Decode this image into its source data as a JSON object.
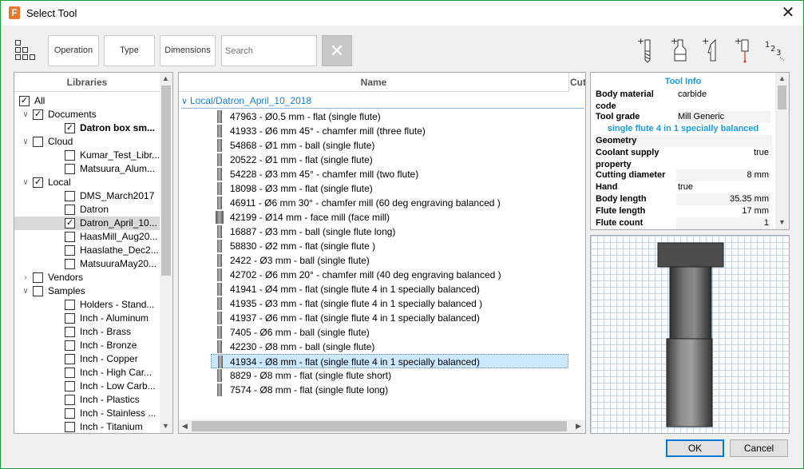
{
  "window": {
    "title": "Select Tool",
    "app_icon_letter": "F"
  },
  "toolbar": {
    "operation_label": "Operation",
    "type_label": "Type",
    "dimensions_label": "Dimensions",
    "search_placeholder": "Search",
    "icons": [
      "view-grid-icon",
      "add-mill-icon",
      "add-holder-icon",
      "add-turning-icon",
      "add-probe-icon",
      "renumber-icon"
    ],
    "renumber_label": "1 2 3"
  },
  "libraries": {
    "header": "Libraries",
    "items": [
      {
        "label": "All",
        "checked": true,
        "caret": "down",
        "level": 0
      },
      {
        "label": "Documents",
        "checked": true,
        "caret": "down",
        "level": 1
      },
      {
        "label": "Datron box sm...",
        "checked": true,
        "caret": "",
        "level": 2,
        "bold": true
      },
      {
        "label": "Cloud",
        "checked": false,
        "caret": "down",
        "level": 1
      },
      {
        "label": "Kumar_Test_Libr...",
        "checked": false,
        "caret": "",
        "level": 2
      },
      {
        "label": "Matsuura_Alum...",
        "checked": false,
        "caret": "",
        "level": 2
      },
      {
        "label": "Local",
        "checked": true,
        "caret": "down",
        "level": 1
      },
      {
        "label": "DMS_March2017",
        "checked": false,
        "caret": "",
        "level": 2
      },
      {
        "label": "Datron",
        "checked": false,
        "caret": "",
        "level": 2
      },
      {
        "label": "Datron_April_10...",
        "checked": true,
        "caret": "",
        "level": 2,
        "selected": true
      },
      {
        "label": "HaasMill_Aug20...",
        "checked": false,
        "caret": "",
        "level": 2
      },
      {
        "label": "Haaslathe_Dec2...",
        "checked": false,
        "caret": "",
        "level": 2
      },
      {
        "label": "MatsuuraMay20...",
        "checked": false,
        "caret": "",
        "level": 2
      },
      {
        "label": "Vendors",
        "checked": false,
        "caret": "right",
        "level": 1
      },
      {
        "label": "Samples",
        "checked": false,
        "caret": "down",
        "level": 1
      },
      {
        "label": "Holders - Stand...",
        "checked": false,
        "caret": "",
        "level": 2
      },
      {
        "label": "Inch - Aluminum",
        "checked": false,
        "caret": "",
        "level": 2
      },
      {
        "label": "Inch - Brass",
        "checked": false,
        "caret": "",
        "level": 2
      },
      {
        "label": "Inch - Bronze",
        "checked": false,
        "caret": "",
        "level": 2
      },
      {
        "label": "Inch - Copper",
        "checked": false,
        "caret": "",
        "level": 2
      },
      {
        "label": "Inch - High Car...",
        "checked": false,
        "caret": "",
        "level": 2
      },
      {
        "label": "Inch - Low Carb...",
        "checked": false,
        "caret": "",
        "level": 2
      },
      {
        "label": "Inch - Plastics",
        "checked": false,
        "caret": "",
        "level": 2
      },
      {
        "label": "Inch - Stainless ...",
        "checked": false,
        "caret": "",
        "level": 2
      },
      {
        "label": "Inch - Titanium",
        "checked": false,
        "caret": "",
        "level": 2
      }
    ]
  },
  "tools": {
    "column_name": "Name",
    "column_cut": "Cut",
    "group_label": "Local/Datron_April_10_2018",
    "rows": [
      {
        "text": "47963 - Ø0.5 mm - flat (single flute)",
        "icon": "endmill-icon"
      },
      {
        "text": "41933 - Ø6 mm 45° - chamfer mill (three flute)",
        "icon": "endmill-icon"
      },
      {
        "text": "54868 - Ø1 mm - ball (single flute)",
        "icon": "endmill-icon"
      },
      {
        "text": "20522 - Ø1 mm - flat (single flute)",
        "icon": "endmill-icon"
      },
      {
        "text": "54228 - Ø3 mm 45° - chamfer mill (two flute)",
        "icon": "endmill-icon"
      },
      {
        "text": "18098 - Ø3 mm - flat (single flute)",
        "icon": "endmill-icon"
      },
      {
        "text": "46911 - Ø6 mm 30° - chamfer mill (60 deg engraving balanced )",
        "icon": "endmill-icon"
      },
      {
        "text": "42199 - Ø14 mm - face mill (face mill)",
        "icon": "facemill-icon"
      },
      {
        "text": "16887 - Ø3 mm - ball (single flute long)",
        "icon": "endmill-icon"
      },
      {
        "text": "58830 - Ø2 mm - flat (single flute )",
        "icon": "endmill-icon"
      },
      {
        "text": "2422 - Ø3 mm - ball (single flute)",
        "icon": "endmill-icon"
      },
      {
        "text": "42702 - Ø6 mm 20° - chamfer mill (40 deg engraving balanced )",
        "icon": "endmill-icon"
      },
      {
        "text": "41941 - Ø4 mm - flat (single flute 4 in 1 specially balanced)",
        "icon": "endmill-icon"
      },
      {
        "text": "41935 - Ø3 mm - flat (single flute 4 in 1 specially balanced )",
        "icon": "endmill-icon"
      },
      {
        "text": "41937 - Ø6 mm - flat (single flute 4 in 1 specially balanced)",
        "icon": "endmill-icon"
      },
      {
        "text": "7405 - Ø6 mm - ball (single flute)",
        "icon": "endmill-icon"
      },
      {
        "text": "42230 - Ø8 mm - ball (single flute)",
        "icon": "endmill-icon"
      },
      {
        "text": "41934 - Ø8 mm - flat (single flute 4 in 1 specially balanced)",
        "icon": "endmill-icon",
        "selected": true
      },
      {
        "text": "8829 - Ø8 mm - flat (single flute short)",
        "icon": "endmill-icon"
      },
      {
        "text": "7574 - Ø8 mm - flat (single flute long)",
        "icon": "endmill-icon"
      }
    ]
  },
  "tool_info": {
    "header": "Tool Info",
    "body_material_key": "Body material code",
    "body_material_val": "carbide",
    "tool_grade_key": "Tool grade",
    "tool_grade_val": "Mill Generic",
    "description": "single flute 4 in 1 specially balanced",
    "geometry_label": "Geometry",
    "coolant_key": "Coolant supply property",
    "coolant_val": "true",
    "cutting_diameter_key": "Cutting diameter",
    "cutting_diameter_val": "8 mm",
    "hand_key": "Hand",
    "hand_val": "true",
    "body_length_key": "Body length",
    "body_length_val": "35.35 mm",
    "flute_length_key": "Flute length",
    "flute_length_val": "17 mm",
    "flute_count_key": "Flute count",
    "flute_count_val": "1",
    "colors": {
      "accent": "#1a9bd7"
    }
  },
  "buttons": {
    "ok": "OK",
    "cancel": "Cancel"
  }
}
